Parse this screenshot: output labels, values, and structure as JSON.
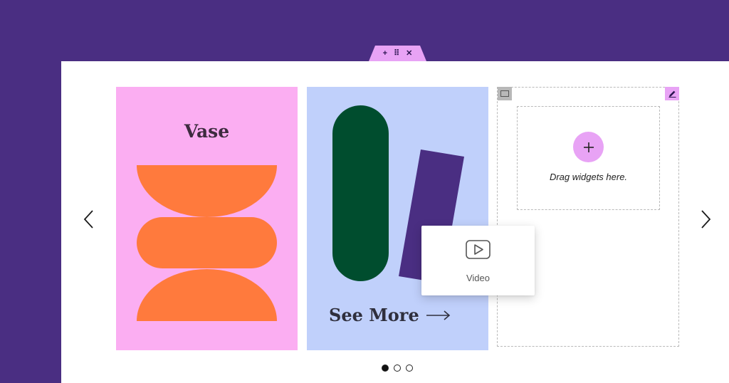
{
  "toolbar": {
    "add_icon": "plus-icon",
    "drag_icon": "drag-grip-icon",
    "close_icon": "close-icon",
    "add_glyph": "+",
    "drag_glyph": "⠿",
    "close_glyph": "✕"
  },
  "carousel": {
    "slides": [
      {
        "title": "Vase",
        "background": "#fbaef2",
        "shape_color": "#ff7a3d"
      },
      {
        "title": "See More",
        "background": "#c0d0fb",
        "shape_colors": [
          "#004d2e",
          "#4a2e82"
        ]
      },
      {
        "type": "empty-drop-area"
      }
    ],
    "prev_icon": "chevron-left-icon",
    "next_icon": "chevron-right-icon",
    "pagination": {
      "count": 3,
      "active_index": 0
    }
  },
  "dropzone": {
    "text": "Drag widgets here.",
    "add_icon": "plus-icon"
  },
  "video_widget": {
    "label": "Video",
    "icon": "video-play-icon"
  },
  "colors": {
    "background": "#4a2e82",
    "accent": "#e8a3f5",
    "canvas": "#ffffff"
  }
}
